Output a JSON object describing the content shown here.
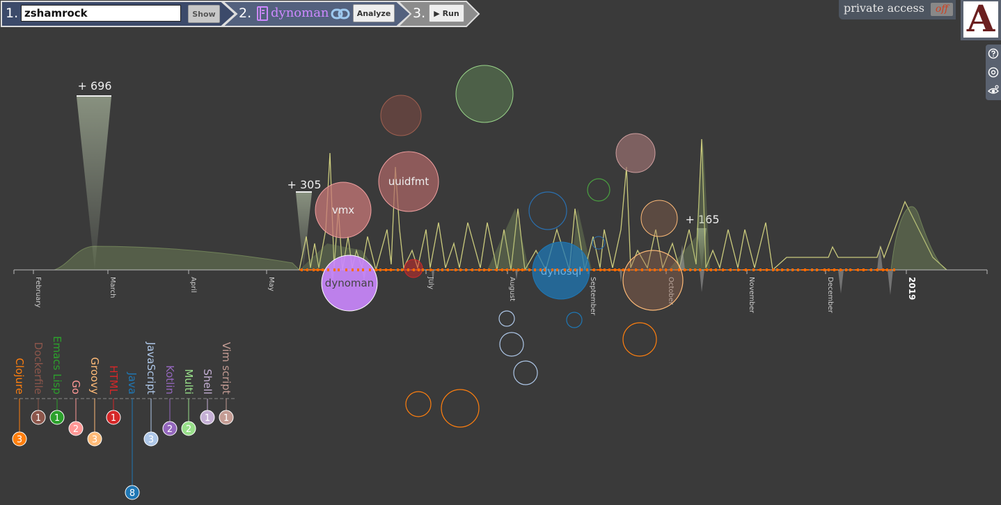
{
  "steps": {
    "step1_num": "1.",
    "step2_num": "2.",
    "step3_num": "3.",
    "username_value": "zshamrock",
    "show_label": "Show",
    "repo_name": "dynoman",
    "analyze_label": "Analyze",
    "run_label": "▶ Run"
  },
  "private_access": {
    "label": "private access",
    "toggle": "off"
  },
  "logo": {
    "letter": "A"
  },
  "tools": [
    "help-icon",
    "settings-icon",
    "eye-icon"
  ],
  "timeline": {
    "months": [
      "February",
      "March",
      "April",
      "May",
      "July",
      "August",
      "September",
      "October",
      "November",
      "December",
      "2019"
    ],
    "peaks": [
      "+ 696",
      "+ 305",
      "+ 165"
    ],
    "repos": [
      "vmx",
      "uuidfmt",
      "dynoman",
      "dynosql"
    ]
  },
  "languages": [
    {
      "name": "Clojure",
      "count": "3",
      "color": "#ff7f0e"
    },
    {
      "name": "Dockerfile",
      "count": "1",
      "color": "#8c564b"
    },
    {
      "name": "Emacs Lisp",
      "count": "1",
      "color": "#2ca02c"
    },
    {
      "name": "Go",
      "count": "2",
      "color": "#ff9896"
    },
    {
      "name": "Groovy",
      "count": "3",
      "color": "#ffbb78"
    },
    {
      "name": "HTML",
      "count": "1",
      "color": "#d62728"
    },
    {
      "name": "Java",
      "count": "8",
      "color": "#1f77b4"
    },
    {
      "name": "JavaScript",
      "count": "3",
      "color": "#aec7e8"
    },
    {
      "name": "Kotlin",
      "count": "2",
      "color": "#9467bd"
    },
    {
      "name": "Multi",
      "count": "2",
      "color": "#98df8a"
    },
    {
      "name": "Shell",
      "count": "1",
      "color": "#c5b0d5"
    },
    {
      "name": "Vim script",
      "count": "1",
      "color": "#c49c94"
    }
  ],
  "colors": {
    "background": "#3a3a3a",
    "accent": "#cc88ff",
    "timeline_line": "#e5e58a",
    "axis": "#ff6a00"
  }
}
